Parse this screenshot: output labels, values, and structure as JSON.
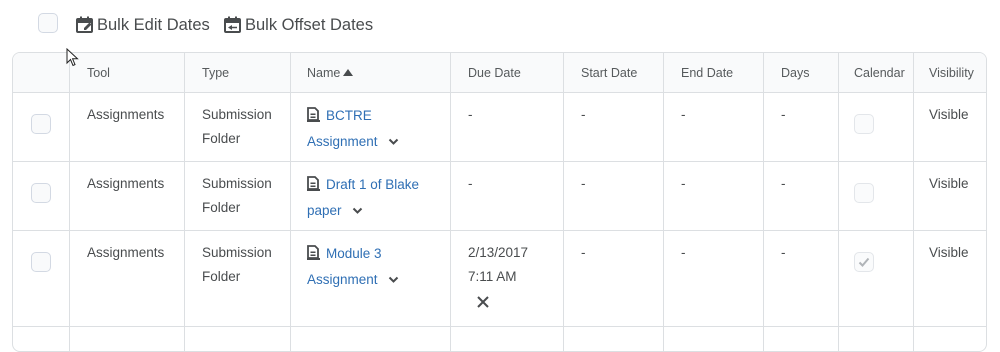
{
  "toolbar": {
    "bulk_edit_label": "Bulk Edit Dates",
    "bulk_offset_label": "Bulk Offset Dates"
  },
  "table": {
    "headers": {
      "tool": "Tool",
      "type": "Type",
      "name": "Name",
      "due": "Due Date",
      "start": "Start Date",
      "end": "End Date",
      "days": "Days",
      "calendar": "Calendar",
      "visibility": "Visibility"
    },
    "sort": {
      "column": "Name",
      "direction": "ascending"
    },
    "rows": [
      {
        "tool": "Assignments",
        "type_line1": "Submission",
        "type_line2": "Folder",
        "name_line1": "BCTRE",
        "name_line2": "Assignment",
        "due_line1": "-",
        "due_line2": "",
        "start": "-",
        "end": "-",
        "days": "-",
        "calendar_checked": false,
        "visibility": "Visible"
      },
      {
        "tool": "Assignments",
        "type_line1": "Submission",
        "type_line2": "Folder",
        "name_line1": "Draft 1 of Blake",
        "name_line2": "paper",
        "due_line1": "-",
        "due_line2": "",
        "start": "-",
        "end": "-",
        "days": "-",
        "calendar_checked": false,
        "visibility": "Visible"
      },
      {
        "tool": "Assignments",
        "type_line1": "Submission",
        "type_line2": "Folder",
        "name_line1": "Module 3",
        "name_line2": "Assignment",
        "due_line1": "2/13/2017",
        "due_line2": "7:11 AM",
        "start": "-",
        "end": "-",
        "days": "-",
        "calendar_checked": true,
        "visibility": "Visible"
      }
    ]
  },
  "icons": {
    "bulk_edit": "calendar-edit-icon",
    "bulk_offset": "calendar-offset-icon",
    "item": "assignment-document-icon",
    "expand": "chevron-down-icon",
    "clear": "close-icon",
    "cursor": "mouse-pointer-icon"
  },
  "colors": {
    "link": "#2f6fb4",
    "text": "#494c4e",
    "border": "#dcdfe2",
    "header_bg": "#f9fafb"
  }
}
